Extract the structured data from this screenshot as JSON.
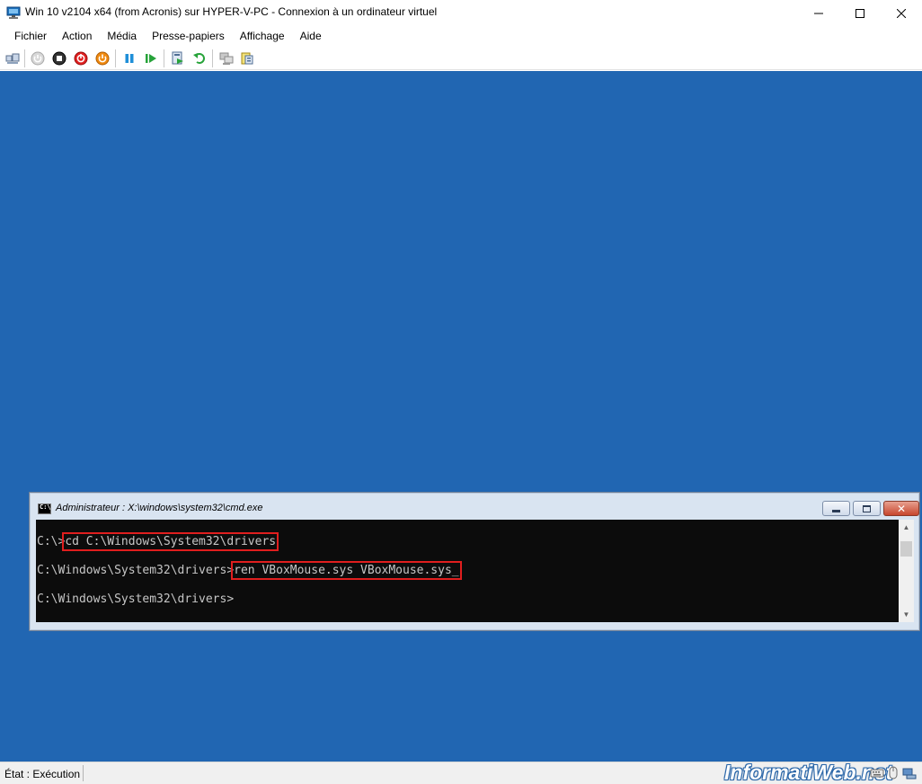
{
  "window": {
    "title": "Win 10 v2104 x64 (from Acronis) sur HYPER-V-PC - Connexion à un ordinateur virtuel",
    "icon": "vm-connect-icon"
  },
  "menu": {
    "items": [
      "Fichier",
      "Action",
      "Média",
      "Presse-papiers",
      "Affichage",
      "Aide"
    ]
  },
  "toolbar": {
    "buttons": [
      "ctrl-alt-del-icon",
      "start-icon",
      "turn-off-icon",
      "shut-down-icon",
      "save-state-icon",
      "pause-icon",
      "resume-icon",
      "checkpoint-icon",
      "revert-icon",
      "enhanced-session-icon",
      "share-icon"
    ]
  },
  "vm": {
    "background_color": "#2166b2"
  },
  "cmd": {
    "title": "Administrateur : X:\\windows\\system32\\cmd.exe",
    "icon_label": "C:\\",
    "lines": [
      {
        "prompt": "C:\\>",
        "command": "cd C:\\Windows\\System32\\drivers",
        "highlighted": true
      },
      {
        "prompt": "C:\\Windows\\System32\\drivers>",
        "command": "ren VBoxMouse.sys VBoxMouse.sys_",
        "highlighted": true
      },
      {
        "prompt": "C:\\Windows\\System32\\drivers>",
        "command": "",
        "highlighted": false
      }
    ],
    "highlight_color": "#e01e1e"
  },
  "status": {
    "text": "État : Exécution",
    "watermark": "InformatiWeb.net"
  }
}
